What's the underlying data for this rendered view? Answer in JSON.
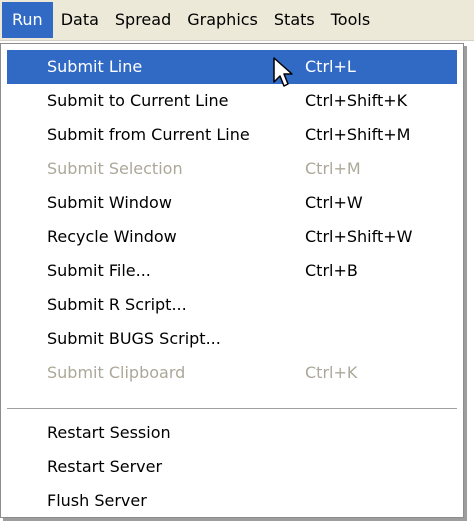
{
  "menubar": {
    "items": [
      "Run",
      "Data",
      "Spread",
      "Graphics",
      "Stats",
      "Tools"
    ],
    "active": "Run"
  },
  "menu": {
    "items": [
      {
        "label": "Submit Line",
        "shortcut": "Ctrl+L",
        "state": "highlighted"
      },
      {
        "label": "Submit to Current Line",
        "shortcut": "Ctrl+Shift+K",
        "state": "enabled"
      },
      {
        "label": "Submit from Current Line",
        "shortcut": "Ctrl+Shift+M",
        "state": "enabled"
      },
      {
        "label": "Submit Selection",
        "shortcut": "Ctrl+M",
        "state": "disabled"
      },
      {
        "label": "Submit Window",
        "shortcut": "Ctrl+W",
        "state": "enabled"
      },
      {
        "label": "Recycle Window",
        "shortcut": "Ctrl+Shift+W",
        "state": "enabled"
      },
      {
        "label": "Submit File...",
        "shortcut": "Ctrl+B",
        "state": "enabled"
      },
      {
        "label": "Submit R Script...",
        "shortcut": "",
        "state": "enabled"
      },
      {
        "label": "Submit BUGS Script...",
        "shortcut": "",
        "state": "enabled"
      },
      {
        "label": "Submit Clipboard",
        "shortcut": "Ctrl+K",
        "state": "disabled"
      },
      {
        "label": "Restart Session",
        "shortcut": "",
        "state": "enabled"
      },
      {
        "label": "Restart Server",
        "shortcut": "",
        "state": "enabled"
      },
      {
        "label": "Flush Server",
        "shortcut": "",
        "state": "enabled"
      }
    ]
  },
  "colors": {
    "highlight": "#316ac5",
    "menubar": "#ece9d8",
    "disabled": "#aca899"
  },
  "icons": {
    "cursor": "mouse-pointer-icon"
  }
}
